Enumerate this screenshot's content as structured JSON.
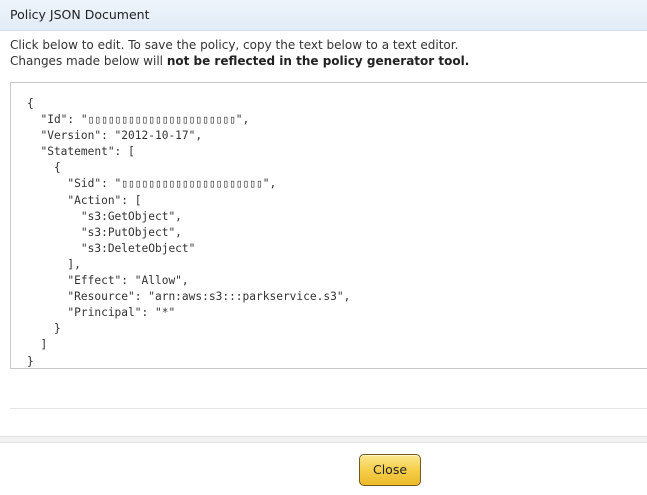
{
  "dialog": {
    "title": "Policy JSON Document",
    "instructions": {
      "line1": "Click below to edit. To save the policy, copy the text below to a text editor.",
      "line2_prefix": "Changes made below will ",
      "line2_bold": "not be reflected in the policy generator tool."
    },
    "policy_json": "{\n  \"Id\": \"▯▯▯▯▯▯▯▯▯▯▯▯▯▯▯▯▯▯▯▯▯▯\",\n  \"Version\": \"2012-10-17\",\n  \"Statement\": [\n    {\n      \"Sid\": \"▯▯▯▯▯▯▯▯▯▯▯▯▯▯▯▯▯▯▯▯▯\",\n      \"Action\": [\n        \"s3:GetObject\",\n        \"s3:PutObject\",\n        \"s3:DeleteObject\"\n      ],\n      \"Effect\": \"Allow\",\n      \"Resource\": \"arn:aws:s3:::parkservice.s3\",\n      \"Principal\": \"*\"\n    }\n  ]\n}",
    "close_label": "Close"
  },
  "colors": {
    "title_bar": "#e6eef8",
    "button_gold": "#f5cf4b",
    "button_border": "#6f5b1d"
  }
}
